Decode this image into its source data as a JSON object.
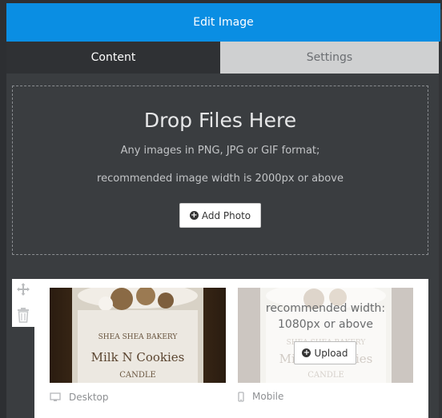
{
  "window": {
    "title": "Edit Image"
  },
  "tabs": [
    {
      "label": "Content",
      "active": true
    },
    {
      "label": "Settings",
      "active": false
    }
  ],
  "dropzone": {
    "title": "Drop Files Here",
    "line1": "Any images in PNG, JPG or GIF format;",
    "line2": "recommended image width is 2000px or above",
    "add_photo_label": "Add Photo"
  },
  "images": {
    "desktop_caption": "Desktop",
    "mobile_caption": "Mobile",
    "mobile_recommend_line1": "recommended width:",
    "mobile_recommend_line2": "1080px or above",
    "upload_label": "Upload",
    "candle_text": {
      "brand": "SHEA SHEA BAKERY",
      "name": "Milk N Cookies",
      "type": "CANDLE"
    }
  },
  "colors": {
    "titlebar": "#0a8ee3",
    "panel": "#3a3d40",
    "tab_inactive": "#cfd0d1"
  }
}
